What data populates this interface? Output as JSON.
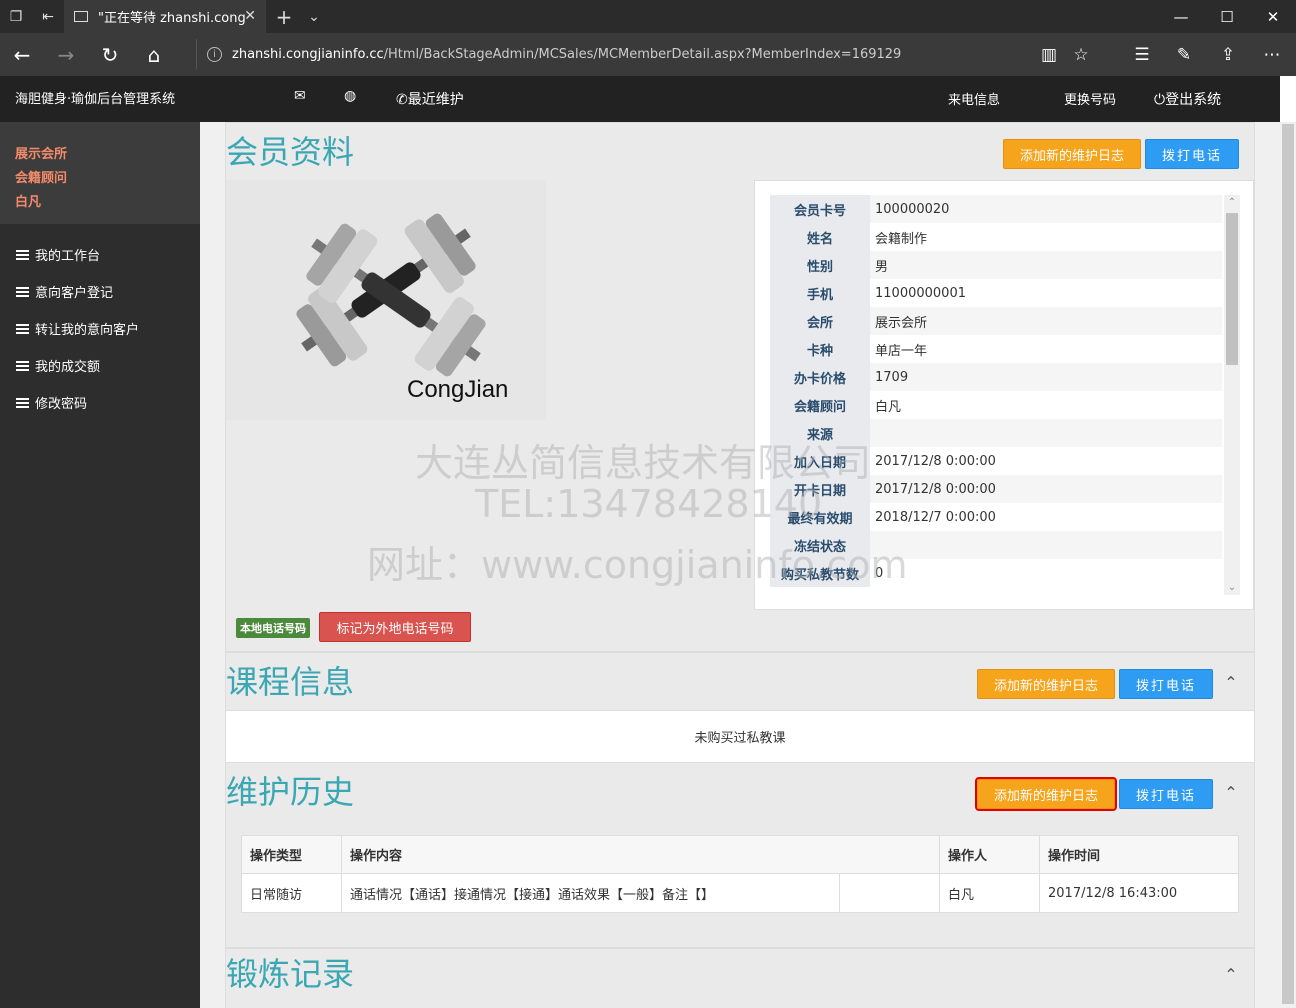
{
  "browser": {
    "tab_title": "\"正在等待 zhanshi.cong",
    "url_host": "zhanshi.congjianinfo.cc",
    "url_path": "/Html/BackStageAdmin/MCSales/MCMemberDetail.aspx?MemberIndex=169129"
  },
  "header": {
    "brand": "海胆健身·瑜伽后台管理系统",
    "recent": "最近维护",
    "incoming": "来电信息",
    "change_number": "更换号码",
    "logout": "登出系统"
  },
  "sidebar": {
    "user_lines": [
      "展示会所",
      "会籍顾问",
      "白凡"
    ],
    "items": [
      {
        "label": "我的工作台"
      },
      {
        "label": "意向客户登记"
      },
      {
        "label": "转让我的意向客户"
      },
      {
        "label": "我的成交额"
      },
      {
        "label": "修改密码"
      }
    ]
  },
  "member": {
    "title": "会员资料",
    "add_log": "添加新的维护日志",
    "call": "拨打电话",
    "photo_caption": "CongJian",
    "fields": [
      {
        "key": "会员卡号",
        "value": "100000020"
      },
      {
        "key": "姓名",
        "value": "会籍制作"
      },
      {
        "key": "性别",
        "value": "男"
      },
      {
        "key": "手机",
        "value": "11000000001"
      },
      {
        "key": "会所",
        "value": "展示会所"
      },
      {
        "key": "卡种",
        "value": "单店一年"
      },
      {
        "key": "办卡价格",
        "value": "1709"
      },
      {
        "key": "会籍顾问",
        "value": "白凡"
      },
      {
        "key": "来源",
        "value": ""
      },
      {
        "key": "加入日期",
        "value": "2017/12/8 0:00:00"
      },
      {
        "key": "开卡日期",
        "value": "2017/12/8 0:00:00"
      },
      {
        "key": "最终有效期",
        "value": "2018/12/7 0:00:00"
      },
      {
        "key": "冻结状态",
        "value": ""
      },
      {
        "key": "购买私教节数",
        "value": "0"
      }
    ],
    "local_phone_badge": "本地电话号码",
    "mark_remote": "标记为外地电话号码"
  },
  "course": {
    "title": "课程信息",
    "add_log": "添加新的维护日志",
    "call": "拨打电话",
    "empty": "未购买过私教课"
  },
  "history": {
    "title": "维护历史",
    "add_log": "添加新的维护日志",
    "call": "拨打电话",
    "columns": [
      "操作类型",
      "操作内容",
      "操作人",
      "操作时间"
    ],
    "rows": [
      {
        "type": "日常随访",
        "content": "通话情况【通话】接通情况【接通】通话效果【一般】备注【】",
        "operator": "白凡",
        "time": "2017/12/8 16:43:00"
      }
    ]
  },
  "exercise": {
    "title": "锻炼记录"
  },
  "watermark": {
    "line1": "大连丛简信息技术有限公司",
    "line2": "TEL:13478428140",
    "line3": "网址：www.congjianinfo.com"
  },
  "colors": {
    "accent_title": "#3aa7b3",
    "orange": "#f7a41d",
    "blue": "#2f9cf4",
    "red": "#d9534f",
    "sidebar_user": "#f28b6b"
  }
}
